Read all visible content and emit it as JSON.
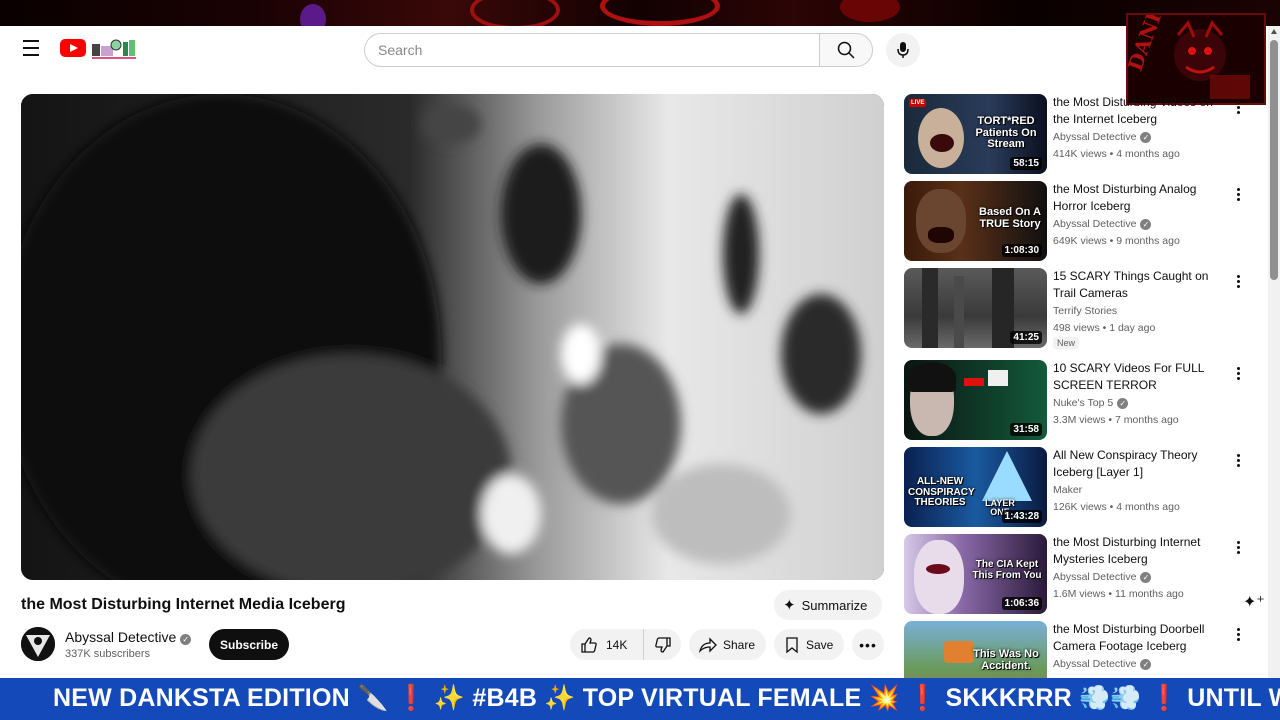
{
  "colors": {
    "accent_red": "#ff0000",
    "ticker_bg": "#1349b8",
    "subscribe_bg": "#0f0f0f"
  },
  "masthead": {
    "search_placeholder": "Search",
    "icons": [
      "menu-icon",
      "youtube-logo",
      "search-icon",
      "mic-icon"
    ]
  },
  "overlay_logo": {
    "text": "DANK",
    "subtext": "ÐĀNK"
  },
  "video": {
    "title": "the Most Disturbing Internet Media Iceberg",
    "summarize_label": "Summarize",
    "channel": "Abyssal Detective",
    "subscribers": "337K subscribers",
    "subscribe_label": "Subscribe",
    "likes": "14K",
    "share_label": "Share",
    "save_label": "Save"
  },
  "recommendations": [
    {
      "title": "the Most Disturbing Videos on the Internet Iceberg",
      "channel": "Abyssal Detective",
      "verified": true,
      "meta": "414K views • 4 months ago",
      "duration": "58:15",
      "thumb_text": "TORT*RED Patients On Stream",
      "live": "LIVE"
    },
    {
      "title": "the Most Disturbing Analog Horror Iceberg",
      "channel": "Abyssal Detective",
      "verified": true,
      "meta": "649K views • 9 months ago",
      "duration": "1:08:30",
      "thumb_text": "Based On A TRUE Story"
    },
    {
      "title": "15 SCARY Things Caught on Trail Cameras",
      "channel": "Terrify Stories",
      "verified": false,
      "meta": "498 views • 1 day ago",
      "duration": "41:25",
      "badge": "New"
    },
    {
      "title": "10 SCARY Videos For FULL SCREEN TERROR",
      "channel": "Nuke's Top 5",
      "verified": true,
      "meta": "3.3M views • 7 months ago",
      "duration": "31:58"
    },
    {
      "title": "All New Conspiracy Theory Iceberg [Layer 1]",
      "channel": "Maker",
      "verified": false,
      "meta": "126K views • 4 months ago",
      "duration": "1:43:28",
      "thumb_text": "ALL-NEW CONSPIRACY THEORIES",
      "thumb_text2": "LAYER ONE"
    },
    {
      "title": "the Most Disturbing Internet Mysteries Iceberg",
      "channel": "Abyssal Detective",
      "verified": true,
      "meta": "1.6M views • 11 months ago",
      "duration": "1:06:36",
      "thumb_text": "The CIA Kept This From You"
    },
    {
      "title": "the Most Disturbing Doorbell Camera Footage Iceberg",
      "channel": "Abyssal Detective",
      "verified": true,
      "meta": "",
      "duration": "",
      "thumb_text": "This Was No Accident."
    }
  ],
  "ticker": {
    "text": "NEW DANKSTA EDITION 🔪 ❗ ✨ #B4B ✨ TOP VIRTUAL FEMALE 💥 ❗ SKKKRRR 💨💨 ❗ UNTIL WE"
  }
}
